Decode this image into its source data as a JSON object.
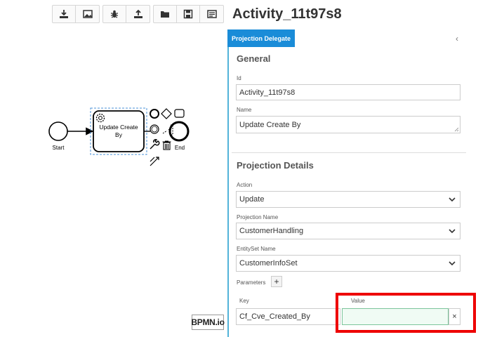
{
  "toolbar": {
    "groups": [
      [
        {
          "icon": "download-icon"
        },
        {
          "icon": "image-icon"
        }
      ],
      [
        {
          "icon": "bug-icon"
        },
        {
          "icon": "upload-icon"
        }
      ],
      [
        {
          "icon": "folder-icon"
        },
        {
          "icon": "save-icon"
        },
        {
          "icon": "window-icon"
        }
      ]
    ]
  },
  "diagram": {
    "start_label": "Start",
    "task_label_line1": "Update Create",
    "task_label_line2": "By",
    "end_label": "End",
    "logo": "BPMN.io"
  },
  "panel": {
    "title": "Activity_11t97s8",
    "active_tab": "Projection Delegate",
    "collapse_glyph": "‹",
    "general": {
      "title": "General",
      "id_label": "Id",
      "id_value": "Activity_11t97s8",
      "name_label": "Name",
      "name_value": "Update Create By"
    },
    "projection": {
      "title": "Projection Details",
      "action_label": "Action",
      "action_value": "Update",
      "projection_name_label": "Projection Name",
      "projection_name_value": "CustomerHandling",
      "entityset_label": "EntitySet Name",
      "entityset_value": "CustomerInfoSet",
      "parameters_label": "Parameters",
      "add_glyph": "+",
      "key_header": "Key",
      "value_header": "Value",
      "rows": [
        {
          "key": "Cf_Cve_Created_By",
          "value": ""
        }
      ],
      "remove_glyph": "×"
    }
  },
  "colors": {
    "accent": "#1a8cd8",
    "panel_border": "#52b3d9",
    "highlight": "#ee0000",
    "value_focus": "#7cc59b"
  }
}
